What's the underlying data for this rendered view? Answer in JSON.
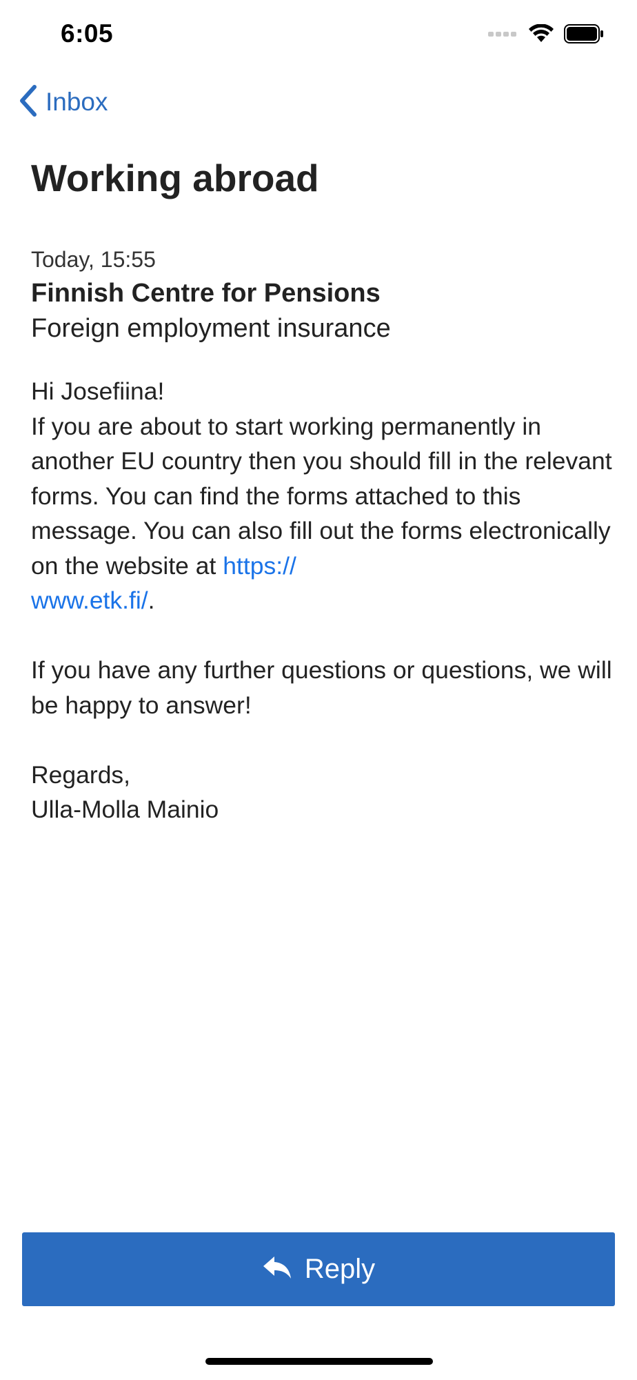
{
  "status_bar": {
    "time": "6:05",
    "icons": [
      "cellular-signal-icon",
      "wifi-icon",
      "battery-icon"
    ]
  },
  "nav": {
    "back_label": "Inbox",
    "back_icon": "chevron-left-icon"
  },
  "message": {
    "title": "Working abroad",
    "date": "Today, 15:55",
    "sender": "Finnish Centre for Pensions",
    "subject": "Foreign employment insurance",
    "greeting": "Hi Josefiina!",
    "paragraph1_text": "If you are about to start working permanently in another EU country then you should fill in the relevant forms. You can find the forms attached to this message. You can also fill out the forms electronically on the website at ",
    "link_text": "https://\nwww.etk.fi/",
    "paragraph1_end": ".",
    "paragraph2": "If you have any further questions or questions, we will be happy to answer!",
    "closing": "Regards,",
    "signature": "Ulla-Molla Mainio"
  },
  "actions": {
    "reply_label": "Reply",
    "reply_icon": "reply-arrow-icon"
  },
  "colors": {
    "accent": "#2b6cbf",
    "link": "#1a73e8",
    "text": "#222222",
    "background": "#ffffff"
  }
}
